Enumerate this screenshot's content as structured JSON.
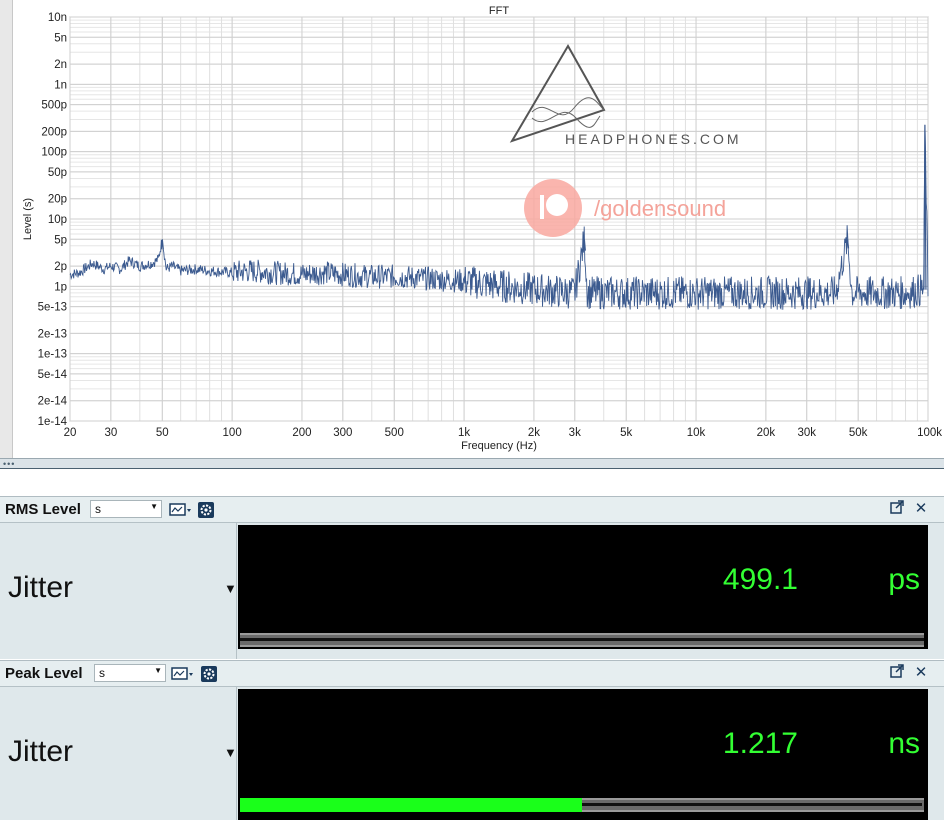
{
  "chart_data": {
    "type": "line",
    "title": "FFT",
    "xlabel": "Frequency (Hz)",
    "ylabel": "Level (s)",
    "x_scale": "log",
    "y_scale": "log",
    "xlim": [
      20,
      100000
    ],
    "ylim": [
      1e-14,
      1e-08
    ],
    "x_ticks": [
      20,
      30,
      50,
      100,
      200,
      300,
      500,
      1000,
      2000,
      3000,
      5000,
      10000,
      20000,
      30000,
      50000,
      100000
    ],
    "x_tick_labels": [
      "20",
      "30",
      "50",
      "100",
      "200",
      "300",
      "500",
      "1k",
      "2k",
      "3k",
      "5k",
      "10k",
      "20k",
      "30k",
      "50k",
      "100k"
    ],
    "y_ticks": [
      1e-08,
      5e-09,
      2e-09,
      1e-09,
      5e-10,
      2e-10,
      1e-10,
      5e-11,
      2e-11,
      1e-11,
      5e-12,
      2e-12,
      1e-12,
      5e-13,
      2e-13,
      1e-13,
      5e-14,
      2e-14,
      1e-14
    ],
    "y_tick_labels": [
      "10n",
      "5n",
      "2n",
      "1n",
      "500p",
      "200p",
      "100p",
      "50p",
      "20p",
      "10p",
      "5p",
      "2p",
      "1p",
      "5e-13",
      "2e-13",
      "1e-13",
      "5e-14",
      "2e-14",
      "1e-14"
    ],
    "grid": true,
    "series": [
      {
        "color": "#3b5a8f",
        "x": [
          20,
          22,
          25,
          28,
          30,
          33,
          36,
          40,
          45,
          48,
          50,
          52,
          55,
          60,
          70,
          80,
          100,
          120,
          150,
          200,
          250,
          300,
          400,
          500,
          700,
          1000,
          1500,
          2000,
          3000,
          3300,
          3400,
          5000,
          7000,
          10000,
          15000,
          20000,
          30000,
          40000,
          45000,
          47000,
          60000,
          80000,
          96000,
          97000,
          100000
        ],
        "y": [
          1.5e-12,
          1.6e-12,
          2.2e-12,
          1.8e-12,
          2e-12,
          1.8e-12,
          2.4e-12,
          2e-12,
          2.2e-12,
          2.5e-12,
          5e-12,
          1.8e-12,
          2e-12,
          1.7e-12,
          1.8e-12,
          1.7e-12,
          1.6e-12,
          1.7e-12,
          1.6e-12,
          1.5e-12,
          1.6e-12,
          1.5e-12,
          1.4e-12,
          1.4e-12,
          1.3e-12,
          1.2e-12,
          1e-12,
          9e-13,
          8e-13,
          5e-12,
          8e-13,
          8e-13,
          8e-13,
          8e-13,
          8e-13,
          8e-13,
          8e-13,
          8e-13,
          5e-12,
          8e-13,
          8e-13,
          8e-13,
          9e-13,
          2.5e-10,
          8e-13
        ]
      }
    ]
  },
  "watermarks": {
    "headphones": "HEADPHONES.COM",
    "goldensound": "/goldensound"
  },
  "meters": [
    {
      "title": "RMS Level",
      "unit_select": "s",
      "label": "Jitter",
      "value": "499.1",
      "unit": "ps",
      "bar_fraction": 0.0
    },
    {
      "title": "Peak Level",
      "unit_select": "s",
      "label": "Jitter",
      "value": "1.217",
      "unit": "ns",
      "bar_fraction": 0.5
    }
  ],
  "colors": {
    "trace": "#3b5a8f",
    "meter_text": "#33ff33",
    "meter_bg": "#000000",
    "bar_fill": "#1aff1a",
    "panel_bg": "#dfe8eb"
  }
}
